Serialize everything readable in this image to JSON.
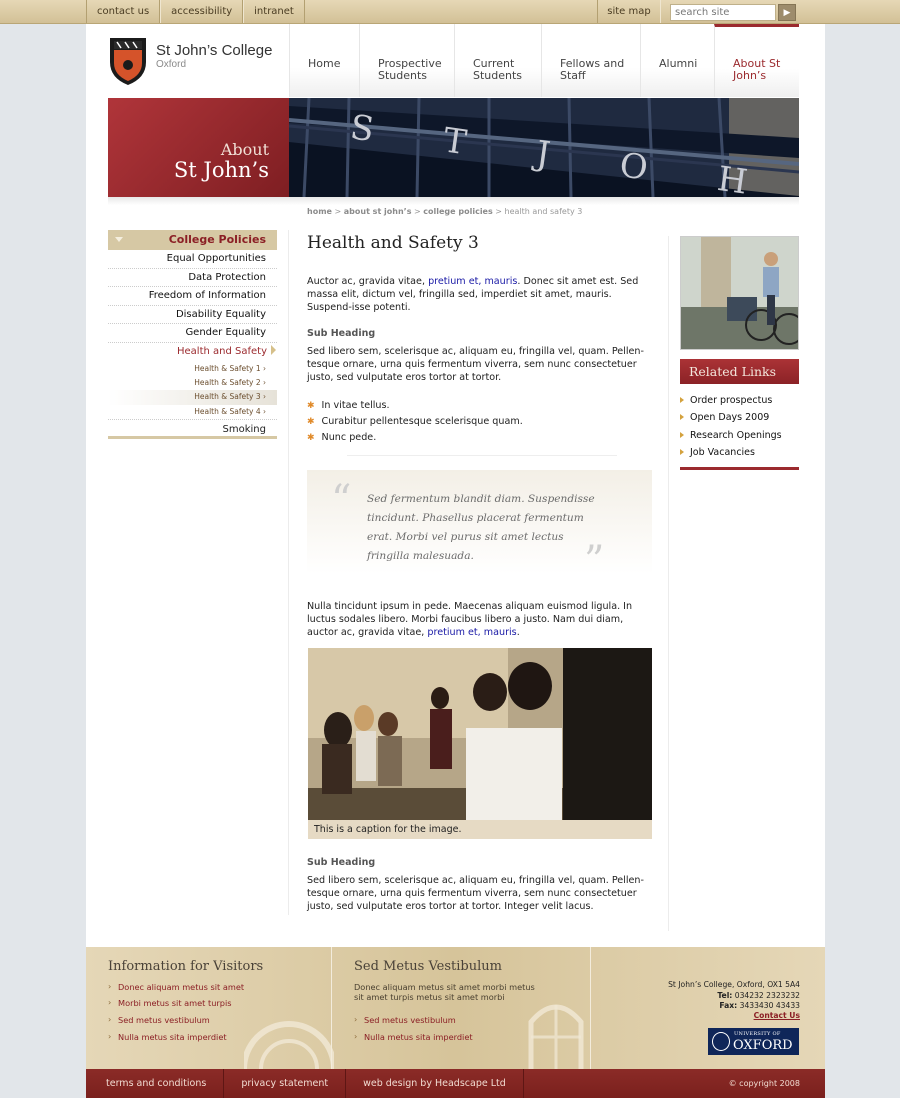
{
  "topbar": {
    "links": [
      "contact us",
      "accessibility",
      "intranet"
    ],
    "site_map": "site map",
    "search_placeholder": "search site"
  },
  "logo": {
    "name": "St John’s College",
    "sub": "Oxford"
  },
  "nav": {
    "items": [
      {
        "label": "Home"
      },
      {
        "label": "Prospective Students"
      },
      {
        "label": "Current Students"
      },
      {
        "label": "Fellows and Staff"
      },
      {
        "label": "Alumni"
      },
      {
        "label": "About St John’s"
      }
    ]
  },
  "hero": {
    "line1": "About",
    "line2": "St John’s",
    "banner_text": "S T  J O H N S"
  },
  "breadcrumb": {
    "home": "home",
    "about": "about st john’s",
    "policies": "college policies",
    "current": "health and safety 3"
  },
  "sidebar": {
    "heading": "College Policies",
    "items": [
      "Equal Opportunities",
      "Data Protection",
      "Freedom of Information",
      "Disability Equality",
      "Gender Equality",
      "Health and Safety"
    ],
    "sub_items": [
      "Health & Safety 1",
      "Health & Safety 2",
      "Health & Safety 3",
      "Health & Safety 4"
    ],
    "last_item": "Smoking"
  },
  "main": {
    "title": "Health and Safety 3",
    "p1_pre": "Auctor ac, gravida vitae, ",
    "p1_link": "pretium et, mauris",
    "p1_post": ". Donec sit amet est. Sed massa elit, dictum vel, fringilla sed, imperdiet sit amet, mauris. Suspend-isse potenti.",
    "sub_heading_1": "Sub Heading",
    "p2": "Sed libero sem, scelerisque ac, aliquam eu, fringilla vel, quam. Pellen-tesque ornare, urna quis fermentum viverra, sem nunc consectetuer justo, sed vulputate eros tortor at tortor.",
    "bullets": [
      "In vitae tellus.",
      "Curabitur pellentesque scelerisque quam.",
      "Nunc pede."
    ],
    "quote": "Sed fermentum blandit diam. Suspendisse tincidunt. Phasellus placerat fermentum erat. Morbi vel purus sit amet lectus fringilla malesuada.",
    "p3_pre": "Nulla tincidunt ipsum in pede. Maecenas aliquam euismod ligula. In luctus sodales libero. Morbi faucibus libero a justo. Nam dui diam, auctor ac, gravida vitae, ",
    "p3_link": "pretium et, mauris",
    "p3_post": ".",
    "caption": "This is a caption for the image.",
    "sub_heading_2": "Sub Heading",
    "p4": "Sed libero sem, scelerisque ac, aliquam eu, fringilla vel, quam. Pellen-tesque ornare, urna quis fermentum viverra, sem nunc consectetuer justo, sed vulputate eros tortor at tortor. Integer velit lacus."
  },
  "related": {
    "heading": "Related Links",
    "items": [
      "Order prospectus",
      "Open Days 2009",
      "Research Openings",
      "Job Vacancies"
    ]
  },
  "footer": {
    "col1_title": "Information for Visitors",
    "col1_links": [
      "Donec aliquam metus sit amet",
      "Morbi metus sit amet turpis",
      "Sed metus vestibulum",
      "Nulla metus sita imperdiet"
    ],
    "col2_title": "Sed Metus Vestibulum",
    "col2_text": "Donec aliquam metus sit amet morbi metus sit amet turpis metus sit amet morbi",
    "col2_links": [
      "Sed metus vestibulum",
      "Nulla metus sita imperdiet"
    ],
    "address": "St John’s College, Oxford, OX1 5A4",
    "tel_label": "Tel:",
    "tel": "034232 2323232",
    "fax_label": "Fax:",
    "fax": "3433430 43433",
    "contact": "Contact Us",
    "oxford_univ": "UNIVERSITY OF",
    "oxford": "OXFORD"
  },
  "bottom": {
    "links": [
      "terms and conditions",
      "privacy statement",
      "web design by Headscape Ltd"
    ],
    "copyright": "© copyright 2008"
  }
}
